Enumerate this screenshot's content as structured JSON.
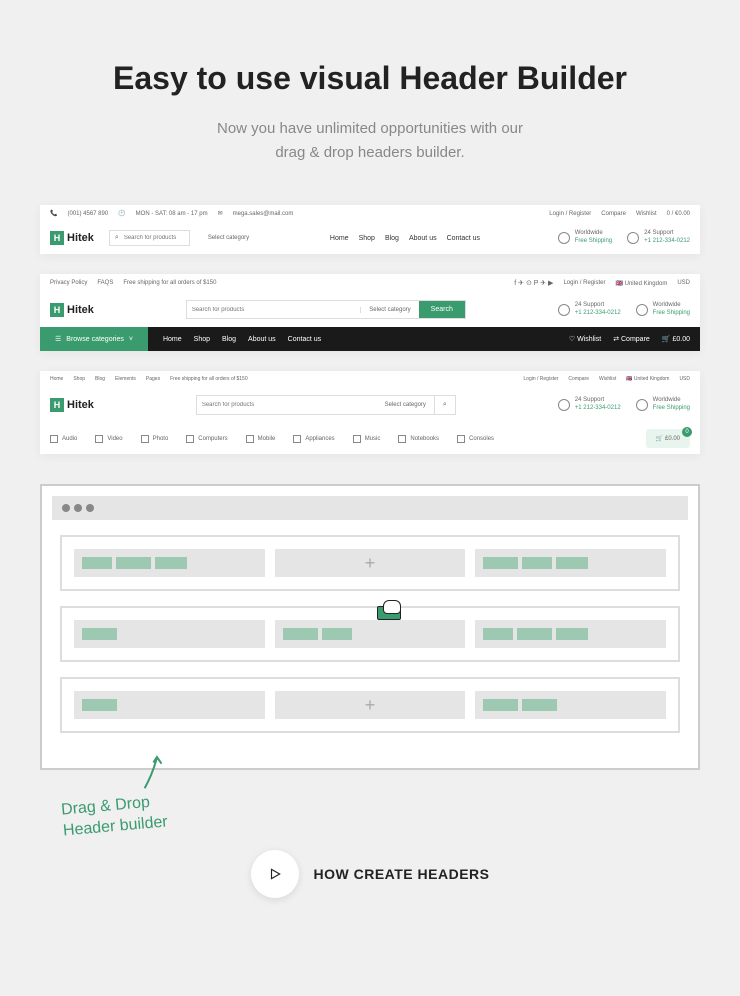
{
  "hero": {
    "title": "Easy to use visual Header Builder",
    "subtitle_l1": "Now you have unlimited opportunities with our",
    "subtitle_l2": "drag & drop headers builder."
  },
  "brand": "Hitek",
  "h1": {
    "topbar": {
      "phone": "(001) 4567 890",
      "hours": "MON - SAT: 08 am - 17 pm",
      "email": "mega.sales@mail.com",
      "login": "Login / Register",
      "compare": "Compare",
      "wishlist": "Wishlist",
      "cart": "0 / €0.00"
    },
    "search_placeholder": "Search for products",
    "category_select": "Select category",
    "nav": {
      "home": "Home",
      "shop": "Shop",
      "blog": "Blog",
      "about": "About us",
      "contact": "Contact us"
    },
    "support": {
      "worldwide": "Worldwide",
      "shipping": "Free Shipping",
      "label": "24 Support",
      "phone": "+1 212-334-0212"
    }
  },
  "h2": {
    "topbar": {
      "privacy": "Privacy Policy",
      "faqs": "FAQS",
      "shipping_msg": "Free shipping for all orders of $150",
      "login": "Login / Register",
      "country": "United Kingdom",
      "currency": "USD"
    },
    "search_placeholder": "Search for products",
    "category_select": "Select category",
    "search_btn": "Search",
    "support": {
      "label": "24 Support",
      "phone": "+1 212-334-0212",
      "worldwide": "Worldwide",
      "shipping": "Free Shipping"
    },
    "blackbar": {
      "browse": "Browse categories",
      "home": "Home",
      "shop": "Shop",
      "blog": "Blog",
      "about": "About us",
      "contact": "Contact us",
      "wishlist": "Wishlist",
      "compare": "Compare",
      "cart": "£0.00"
    }
  },
  "h3": {
    "topnav": {
      "home": "Home",
      "shop": "Shop",
      "blog": "Blog",
      "elements": "Elements",
      "pages": "Pages"
    },
    "shipping_msg": "Free shipping for all orders of $150",
    "topbar": {
      "login": "Login / Register",
      "compare": "Compare",
      "wishlist": "Wishlist",
      "country": "United Kingdom",
      "currency": "USD"
    },
    "search_placeholder": "Search for products",
    "category_select": "Select category",
    "support": {
      "label": "24 Support",
      "phone": "+1 212-334-0212",
      "worldwide": "Worldwide",
      "shipping": "Free Shipping"
    },
    "cats": {
      "audio": "Audio",
      "video": "Video",
      "photo": "Photo",
      "computers": "Computers",
      "mobile": "Mobile",
      "appliances": "Appliances",
      "music": "Music",
      "notebooks": "Notebooks",
      "consoles": "Consoles"
    },
    "cart_price": "£0.00",
    "cart_badge": "0"
  },
  "annotation": {
    "l1": "Drag & Drop",
    "l2": "Header builder"
  },
  "cta": {
    "text": "HOW CREATE HEADERS"
  }
}
